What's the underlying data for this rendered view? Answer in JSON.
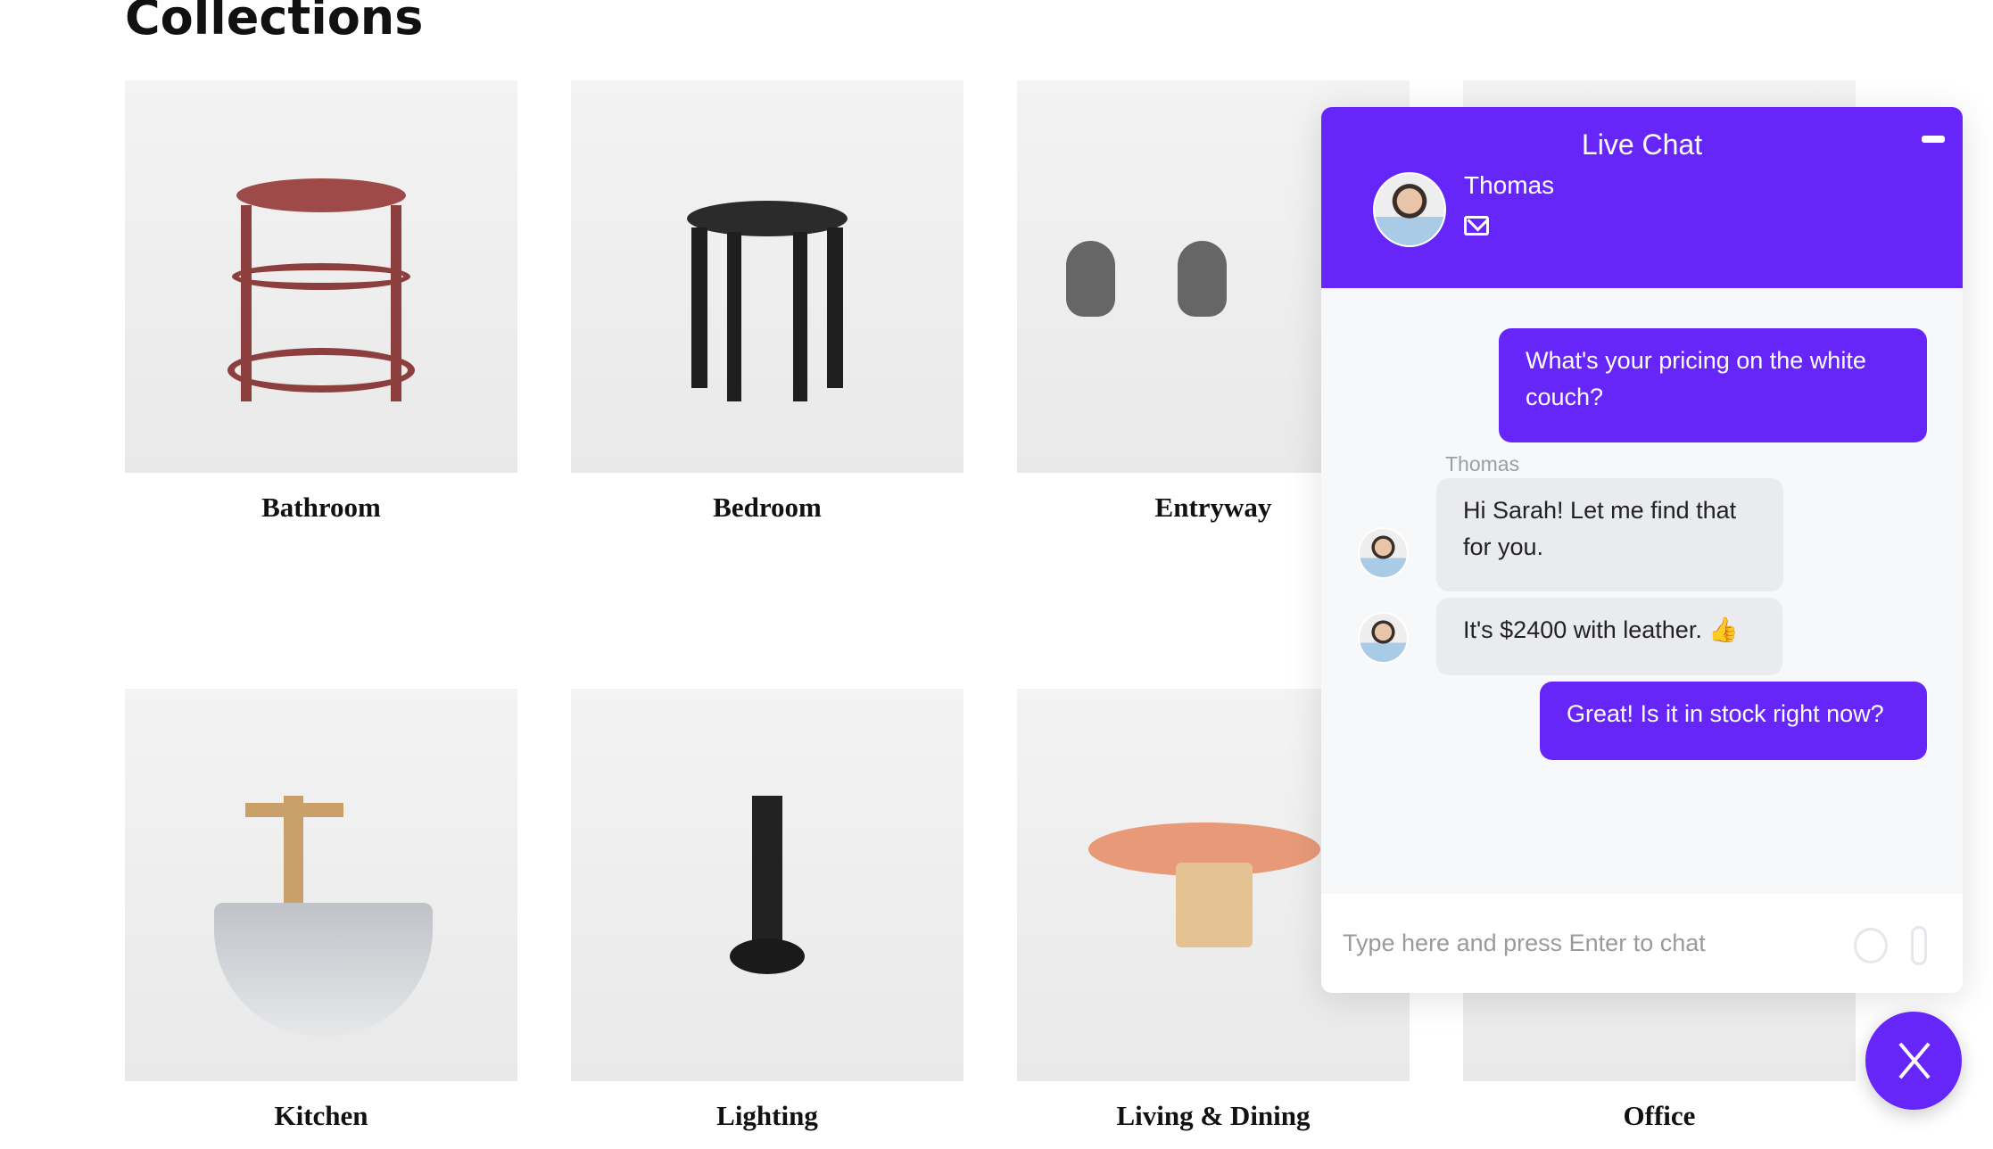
{
  "page": {
    "title": "Collections"
  },
  "collections": [
    {
      "label": "Bathroom"
    },
    {
      "label": "Bedroom"
    },
    {
      "label": "Entryway"
    },
    {
      "label": ""
    },
    {
      "label": "Kitchen"
    },
    {
      "label": "Lighting"
    },
    {
      "label": "Living & Dining"
    },
    {
      "label": "Office"
    }
  ],
  "chat": {
    "title": "Live Chat",
    "agent_name": "Thomas",
    "accent": "#6726f9",
    "messages": [
      {
        "from": "user",
        "text": "What's your pricing on the white couch?"
      },
      {
        "from": "agent",
        "sender": "Thomas",
        "text": "Hi Sarah! Let me find that for you."
      },
      {
        "from": "agent",
        "text": "It's $2400 with leather. 👍"
      },
      {
        "from": "user",
        "text": "Great! Is it in stock right now?"
      }
    ],
    "input_placeholder": "Type here and press Enter to chat",
    "icons": [
      "minimize-icon",
      "mail-icon",
      "emoji-icon",
      "paperclip-icon",
      "close-icon"
    ]
  }
}
